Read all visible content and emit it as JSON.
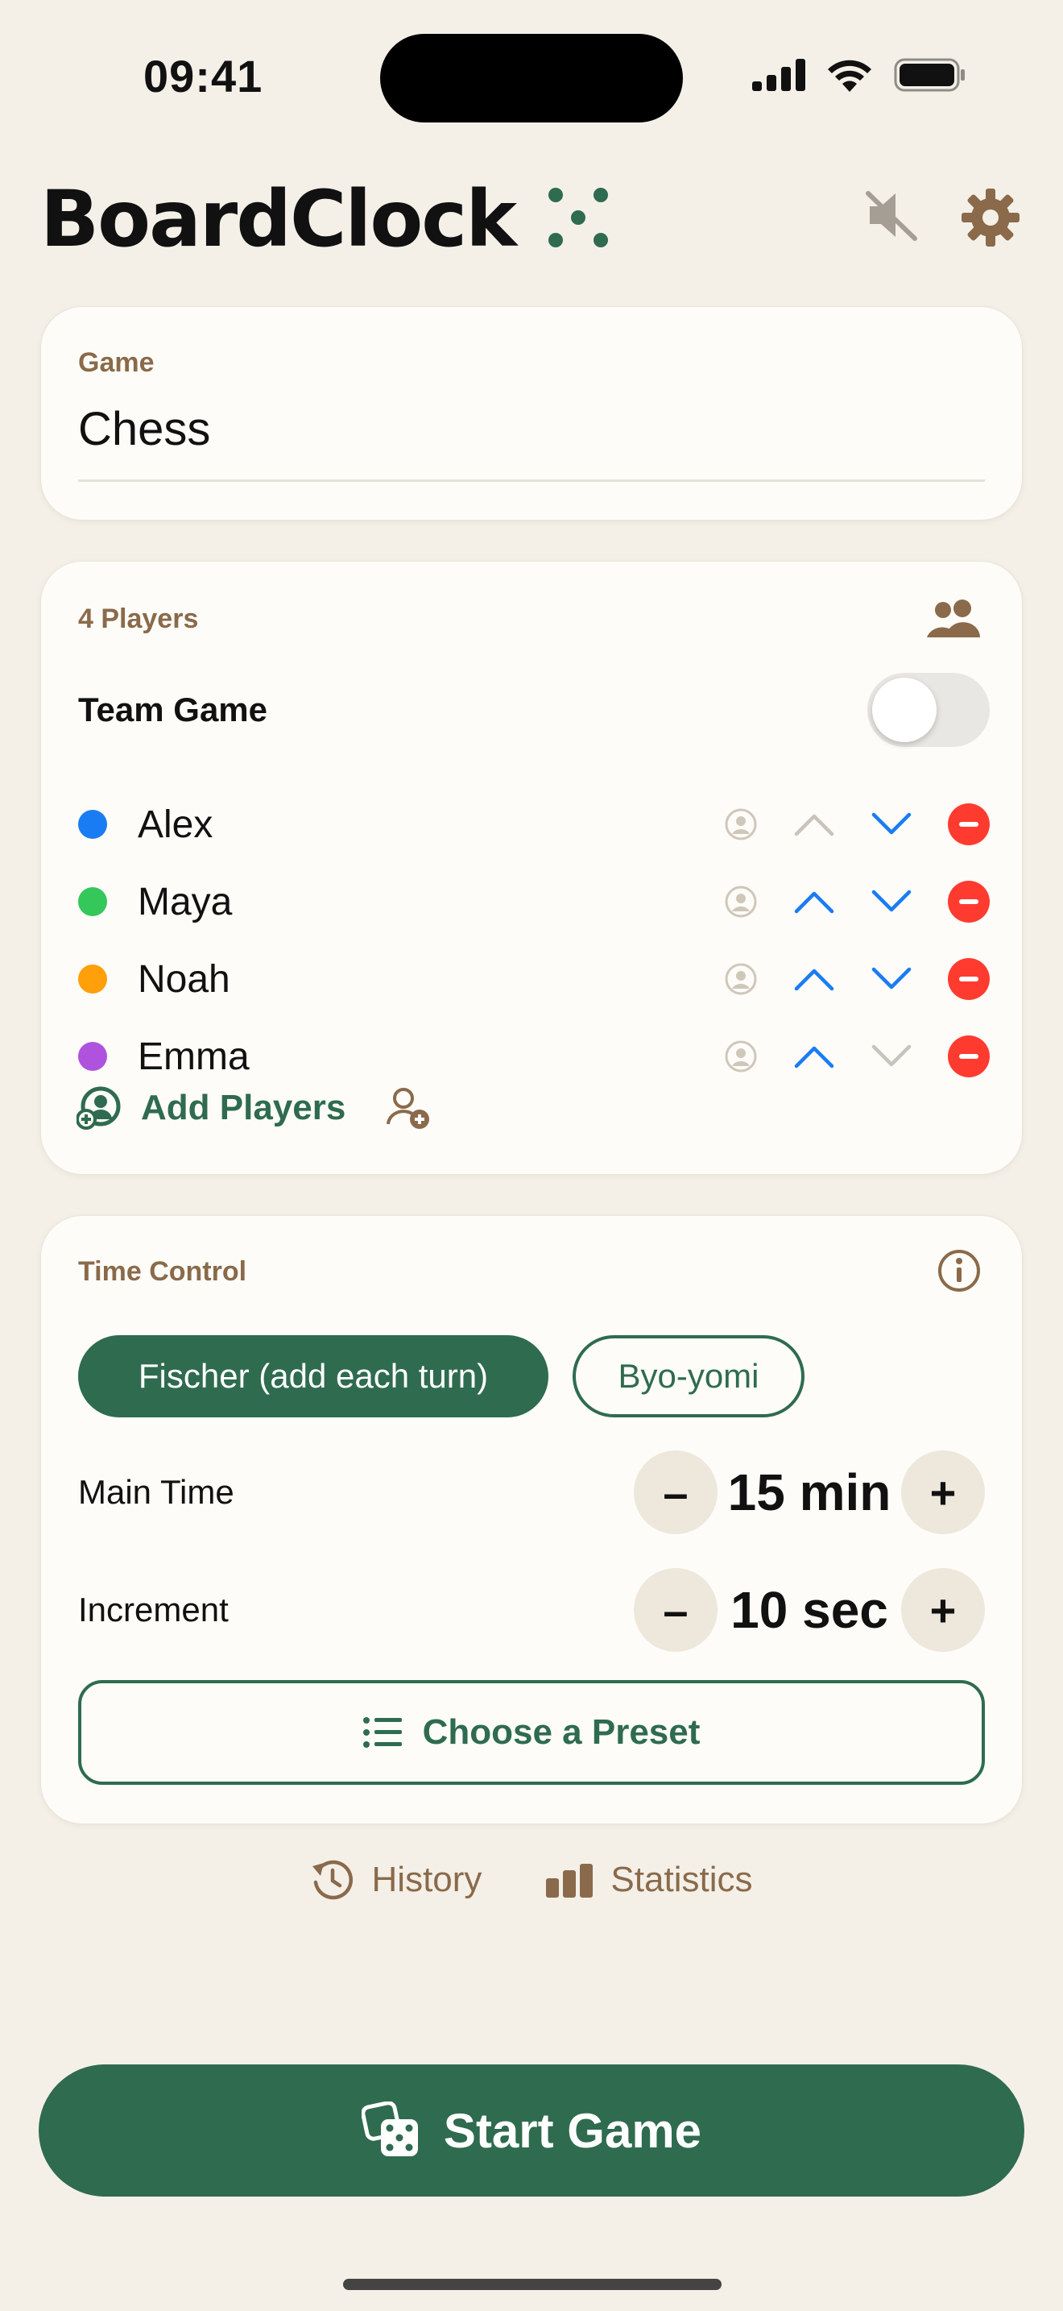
{
  "status_bar": {
    "time": "09:41"
  },
  "header": {
    "title": "BoardClock"
  },
  "game": {
    "label": "Game",
    "value": "Chess"
  },
  "players": {
    "count_label": "4 Players",
    "team_game_label": "Team Game",
    "team_game_enabled": false,
    "items": [
      {
        "name": "Alex",
        "color": "#1a7cf3",
        "can_move_up": false,
        "can_move_down": true
      },
      {
        "name": "Maya",
        "color": "#34c759",
        "can_move_up": true,
        "can_move_down": true
      },
      {
        "name": "Noah",
        "color": "#ff9f0a",
        "can_move_up": true,
        "can_move_down": true
      },
      {
        "name": "Emma",
        "color": "#af52de",
        "can_move_up": true,
        "can_move_down": false
      }
    ],
    "add_label": "Add Players"
  },
  "time_control": {
    "label": "Time Control",
    "modes": [
      "Fischer (add each turn)",
      "Byo-yomi"
    ],
    "selected_mode": "Fischer (add each turn)",
    "main_time_label": "Main Time",
    "main_time_value": "15 min",
    "increment_label": "Increment",
    "increment_value": "10 sec",
    "preset_label": "Choose a Preset"
  },
  "links": {
    "history": "History",
    "statistics": "Statistics"
  },
  "start_label": "Start Game",
  "colors": {
    "accent": "#2f6b4f",
    "label_brown": "#8a6a4a",
    "remove_red": "#ff3b30",
    "arrow_blue": "#1a7cf3"
  }
}
